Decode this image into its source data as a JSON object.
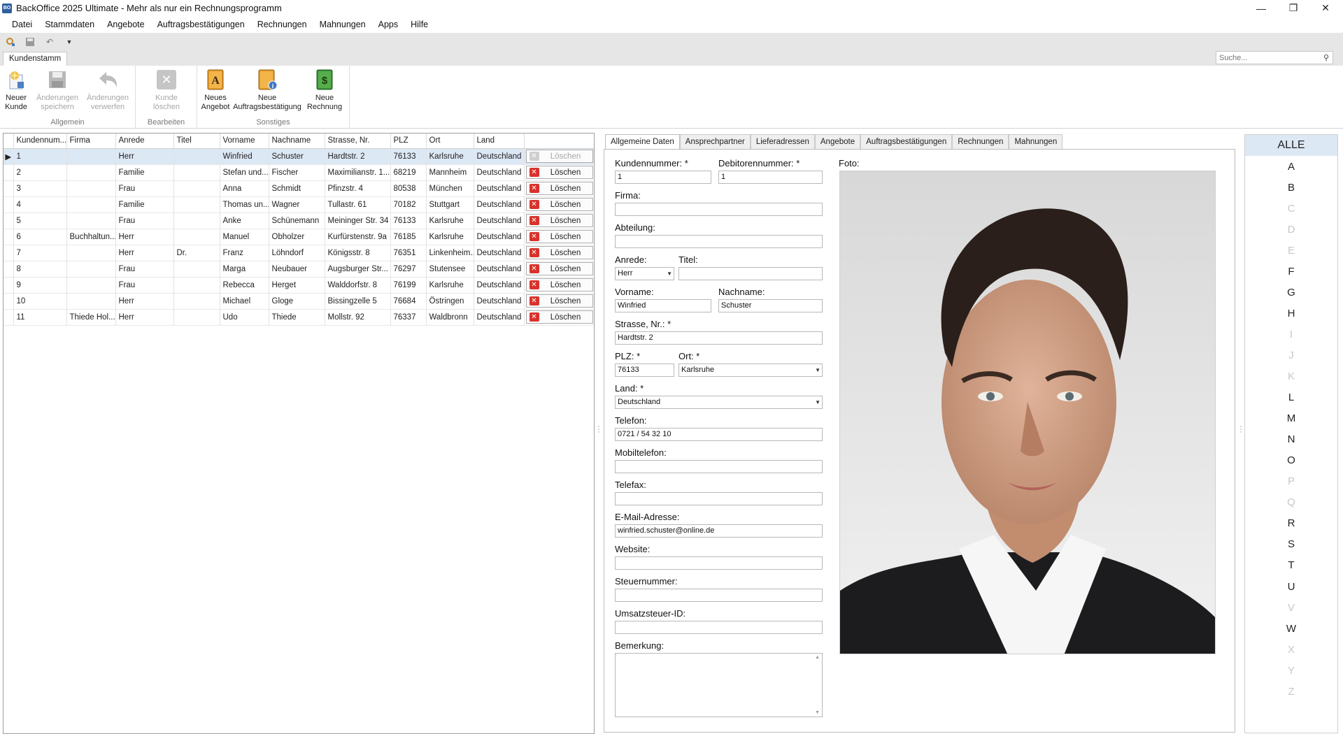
{
  "window": {
    "title": "BackOffice 2025 Ultimate - Mehr als nur ein Rechnungsprogramm",
    "icon_text": "BO"
  },
  "menu": [
    "Datei",
    "Stammdaten",
    "Angebote",
    "Auftragsbestätigungen",
    "Rechnungen",
    "Mahnungen",
    "Apps",
    "Hilfe"
  ],
  "ribbon": {
    "tab": "Kundenstamm",
    "search_placeholder": "Suche...",
    "groups": [
      {
        "label": "Allgemein",
        "buttons": [
          "Neuer\nKunde",
          "Änderungen\nspeichern",
          "Änderungen\nverwerfen"
        ]
      },
      {
        "label": "Bearbeiten",
        "buttons": [
          "Kunde\nlöschen"
        ]
      },
      {
        "label": "Sonstiges",
        "buttons": [
          "Neues\nAngebot",
          "Neue\nAuftragsbestätigung",
          "Neue\nRechnung"
        ]
      }
    ]
  },
  "grid": {
    "columns": [
      "Kundennum...",
      "Firma",
      "Anrede",
      "Titel",
      "Vorname",
      "Nachname",
      "Strasse, Nr.",
      "PLZ",
      "Ort",
      "Land"
    ],
    "delete_label": "Löschen",
    "rows": [
      [
        "1",
        "",
        "Herr",
        "",
        "Winfried",
        "Schuster",
        "Hardtstr. 2",
        "76133",
        "Karlsruhe",
        "Deutschland"
      ],
      [
        "2",
        "",
        "Familie",
        "",
        "Stefan und...",
        "Fischer",
        "Maximilianstr. 1...",
        "68219",
        "Mannheim",
        "Deutschland"
      ],
      [
        "3",
        "",
        "Frau",
        "",
        "Anna",
        "Schmidt",
        "Pfinzstr. 4",
        "80538",
        "München",
        "Deutschland"
      ],
      [
        "4",
        "",
        "Familie",
        "",
        "Thomas un...",
        "Wagner",
        "Tullastr. 61",
        "70182",
        "Stuttgart",
        "Deutschland"
      ],
      [
        "5",
        "",
        "Frau",
        "",
        "Anke",
        "Schünemann",
        "Meininger Str. 34",
        "76133",
        "Karlsruhe",
        "Deutschland"
      ],
      [
        "6",
        "Buchhaltun...",
        "Herr",
        "",
        "Manuel",
        "Obholzer",
        "Kurfürstenstr. 9a",
        "76185",
        "Karlsruhe",
        "Deutschland"
      ],
      [
        "7",
        "",
        "Herr",
        "Dr.",
        "Franz",
        "Löhndorf",
        "Königsstr. 8",
        "76351",
        "Linkenheim...",
        "Deutschland"
      ],
      [
        "8",
        "",
        "Frau",
        "",
        "Marga",
        "Neubauer",
        "Augsburger Str...",
        "76297",
        "Stutensee",
        "Deutschland"
      ],
      [
        "9",
        "",
        "Frau",
        "",
        "Rebecca",
        "Herget",
        "Walddorfstr. 8",
        "76199",
        "Karlsruhe",
        "Deutschland"
      ],
      [
        "10",
        "",
        "Herr",
        "",
        "Michael",
        "Gloge",
        "Bissingzelle 5",
        "76684",
        "Östringen",
        "Deutschland"
      ],
      [
        "11",
        "Thiede Hol...",
        "Herr",
        "",
        "Udo",
        "Thiede",
        "Mollstr. 92",
        "76337",
        "Waldbronn",
        "Deutschland"
      ]
    ]
  },
  "detail_tabs": [
    "Allgemeine Daten",
    "Ansprechpartner",
    "Lieferadressen",
    "Angebote",
    "Auftragsbestätigungen",
    "Rechnungen",
    "Mahnungen"
  ],
  "form": {
    "kundennummer": {
      "label": "Kundennummer: *",
      "value": "1"
    },
    "debitorennummer": {
      "label": "Debitorennummer: *",
      "value": "1"
    },
    "firma": {
      "label": "Firma:",
      "value": ""
    },
    "abteilung": {
      "label": "Abteilung:",
      "value": ""
    },
    "anrede": {
      "label": "Anrede:",
      "value": "Herr"
    },
    "titel": {
      "label": "Titel:",
      "value": ""
    },
    "vorname": {
      "label": "Vorname:",
      "value": "Winfried"
    },
    "nachname": {
      "label": "Nachname:",
      "value": "Schuster"
    },
    "strasse": {
      "label": "Strasse, Nr.: *",
      "value": "Hardtstr. 2"
    },
    "plz": {
      "label": "PLZ: *",
      "value": "76133"
    },
    "ort": {
      "label": "Ort: *",
      "value": "Karlsruhe"
    },
    "land": {
      "label": "Land: *",
      "value": "Deutschland"
    },
    "telefon": {
      "label": "Telefon:",
      "value": "0721 / 54 32 10"
    },
    "mobiltelefon": {
      "label": "Mobiltelefon:",
      "value": ""
    },
    "telefax": {
      "label": "Telefax:",
      "value": ""
    },
    "email": {
      "label": "E-Mail-Adresse:",
      "value": "winfried.schuster@online.de"
    },
    "website": {
      "label": "Website:",
      "value": ""
    },
    "steuernummer": {
      "label": "Steuernummer:",
      "value": ""
    },
    "ustid": {
      "label": "Umsatzsteuer-ID:",
      "value": ""
    },
    "bemerkung": {
      "label": "Bemerkung:",
      "value": ""
    },
    "foto": {
      "label": "Foto:"
    }
  },
  "alphabet": {
    "items": [
      "ALLE",
      "A",
      "B",
      "C",
      "D",
      "E",
      "F",
      "G",
      "H",
      "I",
      "J",
      "K",
      "L",
      "M",
      "N",
      "O",
      "P",
      "Q",
      "R",
      "S",
      "T",
      "U",
      "V",
      "W",
      "X",
      "Y",
      "Z"
    ],
    "disabled": [
      "C",
      "D",
      "E",
      "I",
      "J",
      "K",
      "P",
      "Q",
      "V",
      "X",
      "Y",
      "Z"
    ],
    "selected": "ALLE"
  }
}
